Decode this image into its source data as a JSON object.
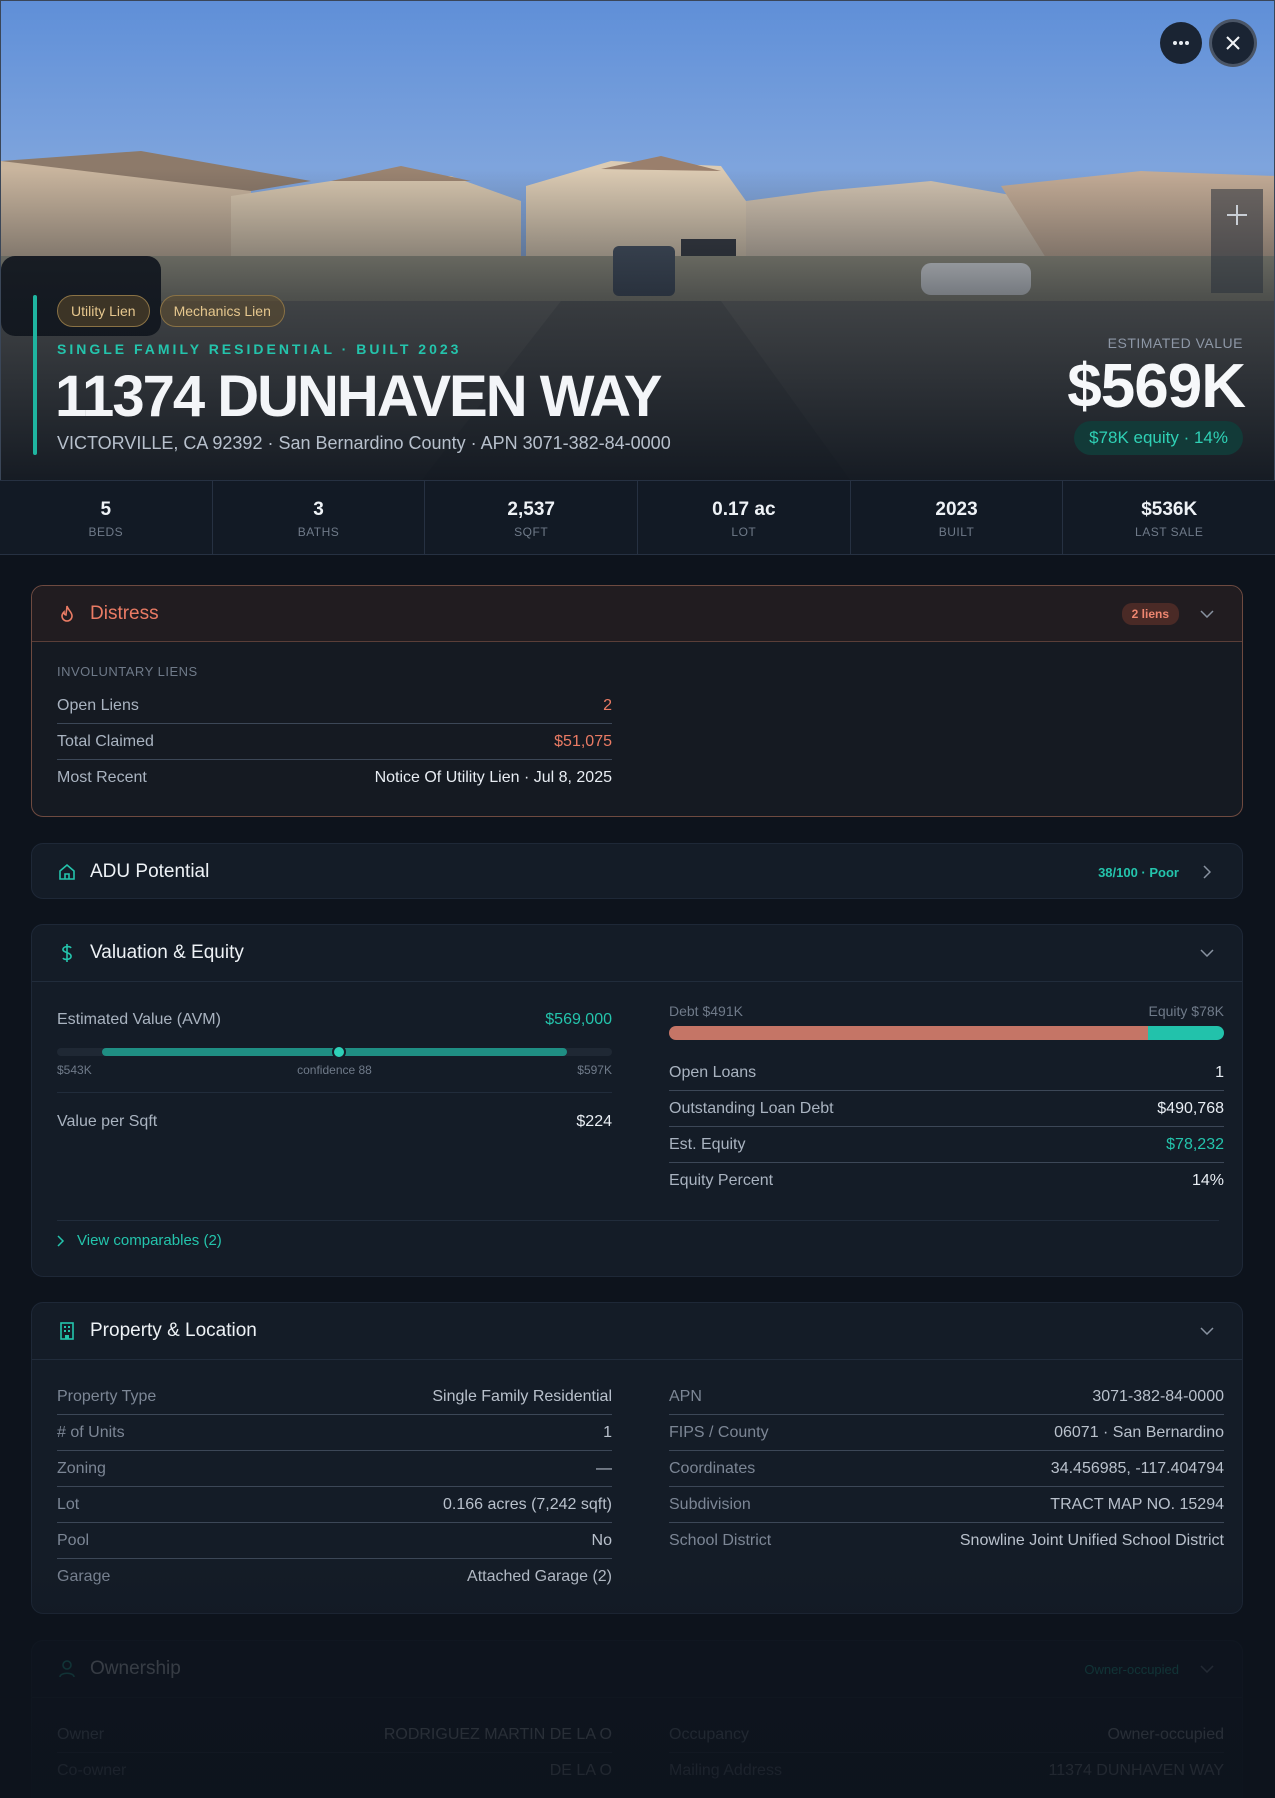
{
  "hero": {
    "badges": [
      "Utility Lien",
      "Mechanics Lien"
    ],
    "eyebrow": "SINGLE FAMILY RESIDENTIAL · BUILT 2023",
    "address": "11374 DUNHAVEN WAY",
    "subline": "VICTORVILLE, CA 92392 · San Bernardino County · APN 3071-382-84-0000",
    "estimated_label": "ESTIMATED VALUE",
    "estimated_value": "$569K",
    "equity_pill": "$78K equity · 14%",
    "icons": {
      "more": "more-horizontal-icon",
      "close": "close-icon",
      "zoom_in": "plus-icon"
    }
  },
  "stats": [
    {
      "value": "5",
      "label": "BEDS"
    },
    {
      "value": "3",
      "label": "BATHS"
    },
    {
      "value": "2,537",
      "label": "SQFT"
    },
    {
      "value": "0.17 ac",
      "label": "LOT"
    },
    {
      "value": "2023",
      "label": "BUILT"
    },
    {
      "value": "$536K",
      "label": "LAST SALE"
    }
  ],
  "distress": {
    "title": "Distress",
    "pill": "2 liens",
    "section_label": "INVOLUNTARY LIENS",
    "rows": [
      {
        "k": "Open Liens",
        "v": "2"
      },
      {
        "k": "Total Claimed",
        "v": "$51,075"
      },
      {
        "k": "Most Recent",
        "v": "Notice Of Utility Lien · Jul 8, 2025"
      }
    ]
  },
  "adu": {
    "title": "ADU Potential",
    "pill": "38/100 · Poor"
  },
  "valuation": {
    "title": "Valuation & Equity",
    "avm_label": "Estimated Value (AVM)",
    "avm_value": "$569,000",
    "avm_low": "$543K",
    "avm_conf": "confidence 88",
    "avm_high": "$597K",
    "value_per_sqft_label": "Value per Sqft",
    "value_per_sqft": "$224",
    "debt_label": "Debt $491K",
    "equity_label": "Equity $78K",
    "debt_fraction": 0.863,
    "rows": [
      {
        "k": "Open Loans",
        "v": "1"
      },
      {
        "k": "Outstanding Loan Debt",
        "v": "$490,768"
      },
      {
        "k": "Est. Equity",
        "v": "$78,232"
      },
      {
        "k": "Equity Percent",
        "v": "14%"
      }
    ],
    "comps_link": "View comparables (2)"
  },
  "property": {
    "title": "Property & Location",
    "left": [
      {
        "k": "Property Type",
        "v": "Single Family Residential"
      },
      {
        "k": "# of Units",
        "v": "1"
      },
      {
        "k": "Zoning",
        "v": "—"
      },
      {
        "k": "Lot",
        "v": "0.166 acres (7,242 sqft)"
      },
      {
        "k": "Pool",
        "v": "No"
      },
      {
        "k": "Garage",
        "v": "Attached Garage (2)"
      }
    ],
    "right": [
      {
        "k": "APN",
        "v": "3071-382-84-0000"
      },
      {
        "k": "FIPS / County",
        "v": "06071 · San Bernardino"
      },
      {
        "k": "Coordinates",
        "v": "34.456985, -117.404794"
      },
      {
        "k": "Subdivision",
        "v": "TRACT MAP NO. 15294"
      },
      {
        "k": "School District",
        "v": "Snowline Joint Unified School District"
      }
    ]
  },
  "ownership": {
    "title": "Ownership",
    "pill": "Owner-occupied",
    "left": [
      {
        "k": "Owner",
        "v": "RODRIGUEZ MARTIN DE LA O"
      },
      {
        "k": "Co-owner",
        "v": "DE LA O"
      }
    ],
    "right": [
      {
        "k": "Occupancy",
        "v": "Owner-occupied"
      },
      {
        "k": "Mailing Address",
        "v": "11374 DUNHAVEN WAY"
      }
    ]
  },
  "colors": {
    "accent": "#24c4ac",
    "distress": "#ea7b64",
    "lien_badge": "#e6c78e",
    "debt": "#c57566"
  }
}
